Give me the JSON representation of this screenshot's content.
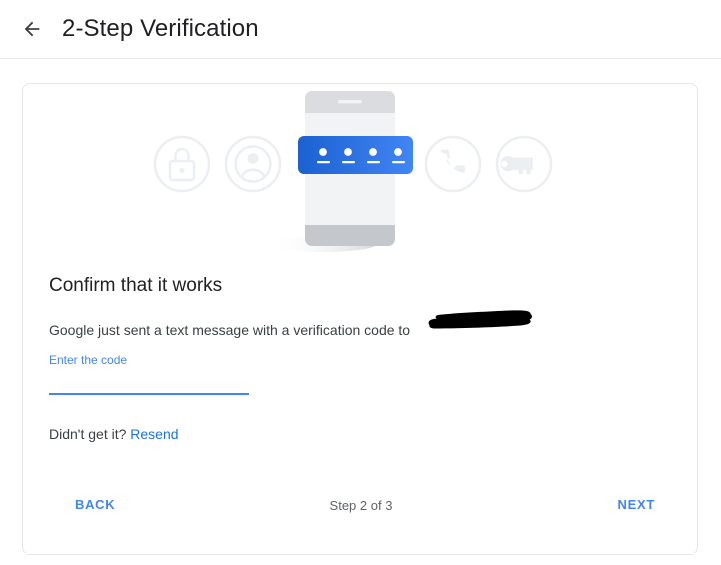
{
  "header": {
    "back_icon": "arrow-left-icon",
    "title": "2-Step Verification"
  },
  "illustration": {
    "icons": [
      "lock-icon",
      "account-circle-icon",
      "phone-device",
      "call-icon",
      "key-icon"
    ],
    "code_dots": 4,
    "colors": {
      "circle_stroke": "#eceff1",
      "phone_body": "#f1f3f4",
      "phone_trim": "#dadce0",
      "code_bar_from": "#1b61d1",
      "code_bar_to": "#4285f4"
    }
  },
  "main": {
    "heading": "Confirm that it works",
    "description": "Google just sent a text message with a verification code to",
    "redacted_value": "",
    "code_field": {
      "label": "Enter the code",
      "value": "",
      "placeholder": ""
    },
    "resend": {
      "prompt": "Didn't get it?",
      "link_label": "Resend"
    }
  },
  "footer": {
    "back_label": "BACK",
    "step_label": "Step 2 of 3",
    "next_label": "NEXT"
  },
  "colors": {
    "accent_blue": "#4285f4",
    "link_blue": "#1a73e8",
    "text_primary": "#202124",
    "text_secondary": "#5f6368",
    "border": "#e4e6e8",
    "redaction": "#000000"
  }
}
